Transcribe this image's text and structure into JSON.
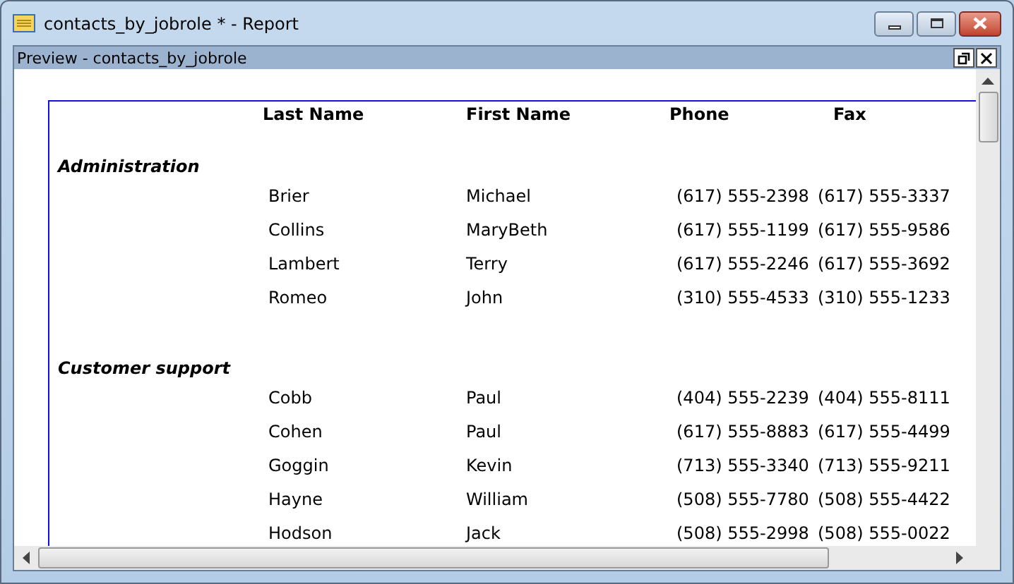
{
  "window": {
    "title": "contacts_by_jobrole * - Report"
  },
  "preview": {
    "title": "Preview - contacts_by_jobrole"
  },
  "table": {
    "columns": [
      "Last Name",
      "First Name",
      "Phone",
      "Fax"
    ],
    "groups": [
      {
        "name": "Administration",
        "rows": [
          [
            "Brier",
            "Michael",
            "(617) 555-2398",
            "(617) 555-3337"
          ],
          [
            "Collins",
            "MaryBeth",
            "(617) 555-1199",
            "(617) 555-9586"
          ],
          [
            "Lambert",
            "Terry",
            "(617) 555-2246",
            "(617) 555-3692"
          ],
          [
            "Romeo",
            "John",
            "(310) 555-4533",
            "(310) 555-1233"
          ]
        ]
      },
      {
        "name": "Customer support",
        "rows": [
          [
            "Cobb",
            "Paul",
            "(404) 555-2239",
            "(404) 555-8111"
          ],
          [
            "Cohen",
            "Paul",
            "(617) 555-8883",
            "(617) 555-4499"
          ],
          [
            "Goggin",
            "Kevin",
            "(713) 555-3340",
            "(713) 555-9211"
          ],
          [
            "Hayne",
            "William",
            "(508) 555-7780",
            "(508) 555-4422"
          ],
          [
            "Hodson",
            "Jack",
            "(508) 555-2998",
            "(508) 555-0022"
          ]
        ]
      }
    ]
  }
}
